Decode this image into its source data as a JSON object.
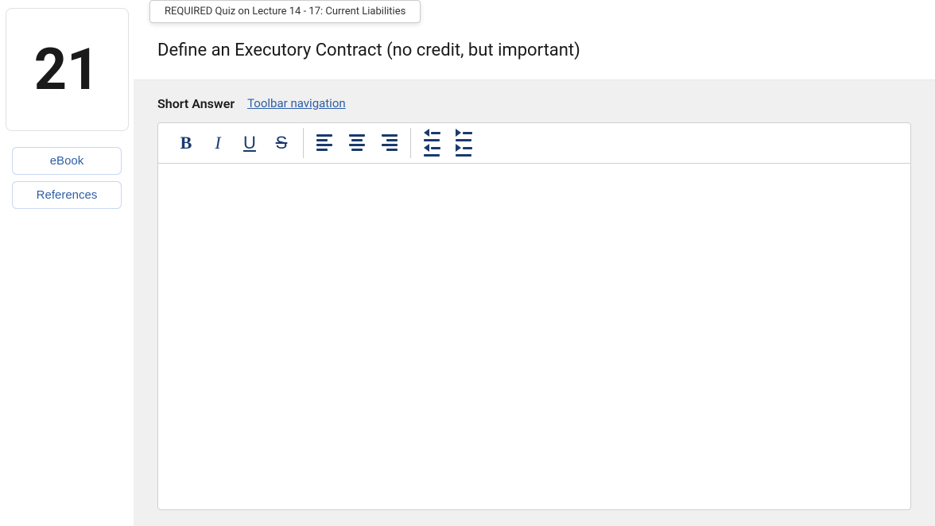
{
  "tooltip": {
    "text": "REQUIRED Quiz on Lecture 14 - 17: Current Liabilities"
  },
  "sidebar": {
    "question_number": "21",
    "ebook_label": "eBook",
    "references_label": "References"
  },
  "question": {
    "text": "Define an Executory Contract (no credit, but important)"
  },
  "answer": {
    "label": "Short Answer",
    "toolbar_nav_label": "Toolbar navigation",
    "toolbar": {
      "bold": "B",
      "italic": "I",
      "underline": "U",
      "strikethrough": "S"
    }
  }
}
